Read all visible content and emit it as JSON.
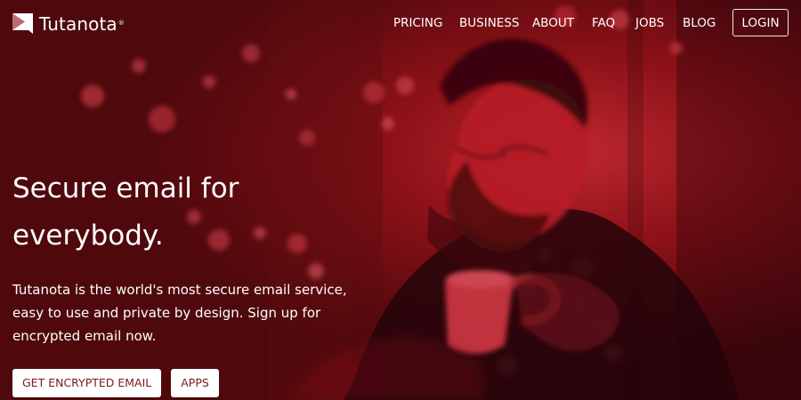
{
  "brand": {
    "name": "Tutanota",
    "registered_mark": "®"
  },
  "nav": {
    "items": [
      {
        "label": "PRICING"
      },
      {
        "label": "BUSINESS"
      },
      {
        "label": "ABOUT"
      },
      {
        "label": "FAQ"
      },
      {
        "label": "JOBS"
      },
      {
        "label": "BLOG"
      }
    ],
    "login_label": "LOGIN"
  },
  "hero": {
    "headline_line1": "Secure email for",
    "headline_line2": "everybody.",
    "subtitle_line1": "Tutanota is the world's most secure email service,",
    "subtitle_line2": "easy to use and private by design. Sign up for",
    "subtitle_line3": "encrypted email now.",
    "primary_cta": "GET ENCRYPTED EMAIL",
    "secondary_cta": "APPS"
  },
  "colors": {
    "overlay": "#8f1015",
    "button_text": "#7b1a1d",
    "white": "#ffffff"
  },
  "icons": {
    "logo": "tutanota-logo-icon"
  }
}
